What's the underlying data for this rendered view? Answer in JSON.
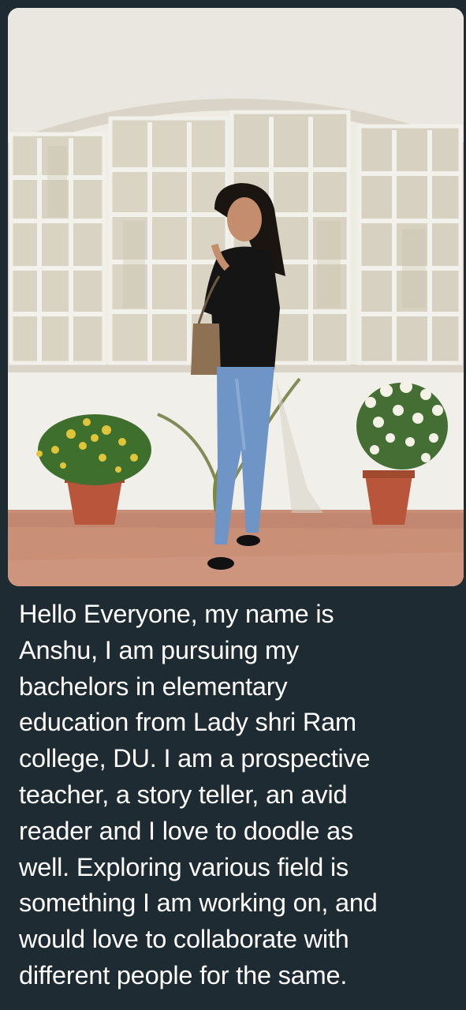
{
  "post": {
    "photo_alt": "Woman standing in front of a white arched window with potted flowers",
    "caption_lines": [
      "Hello Everyone, my name is",
      "Anshu, I am pursuing my",
      "bachelors in elementary",
      "education from Lady shri Ram",
      "college, DU. I am a prospective",
      "teacher, a story teller, an avid",
      "reader and I love to doodle as",
      "well. Exploring various field is",
      "something I am working on, and",
      "would love to collaborate with",
      "different people for the same."
    ]
  },
  "colors": {
    "background": "#1e2b33",
    "text": "#ffffff",
    "wall": "#ece9e1",
    "floor": "#c98f77"
  }
}
